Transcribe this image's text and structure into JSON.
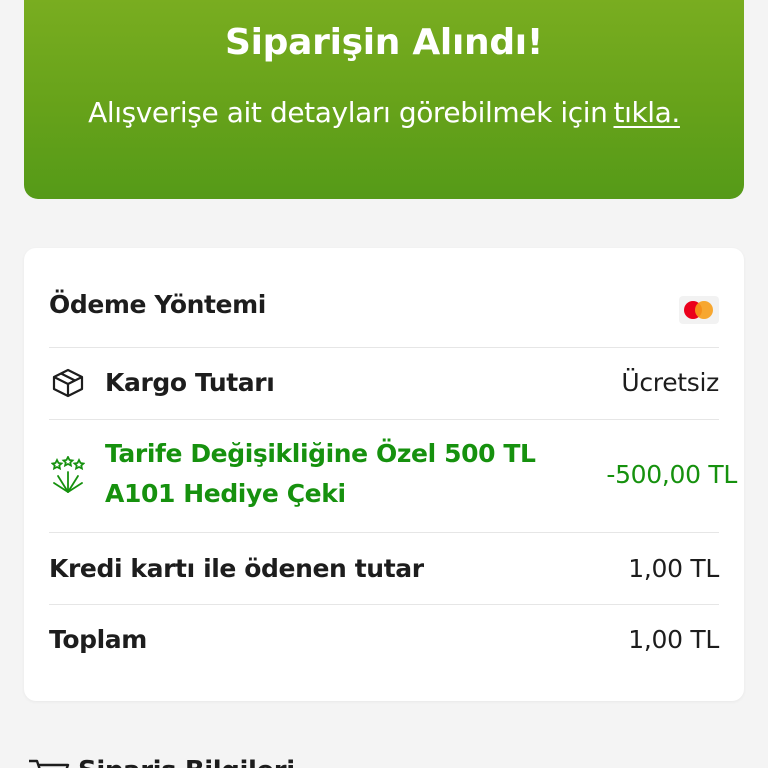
{
  "banner": {
    "title": "Siparişin Alındı!",
    "subtitle": "Alışverişe ait detayları görebilmek için",
    "link": "tıkla."
  },
  "summary": {
    "payment_method_label": "Ödeme Yöntemi",
    "payment_method_icon": "mastercard-icon",
    "shipping_label": "Kargo Tutarı",
    "shipping_value": "Ücretsiz",
    "shipping_icon": "box-icon",
    "gift_label_line1": "Tarife Değişikliğine Özel 500 TL",
    "gift_label_line2": "A101 Hediye Çeki",
    "gift_value": "-500,00 TL",
    "gift_icon": "celebration-icon",
    "credit_label": "Kredi kartı ile ödenen tutar",
    "credit_value": "1,00 TL",
    "total_label": "Toplam",
    "total_value": "1,00 TL"
  },
  "next_section": {
    "title": "Sipariş Bilgileri",
    "icon": "cart-icon"
  },
  "colors": {
    "banner_green": "#66a21a",
    "discount_green": "#16910e",
    "background": "#f4f4f4"
  }
}
